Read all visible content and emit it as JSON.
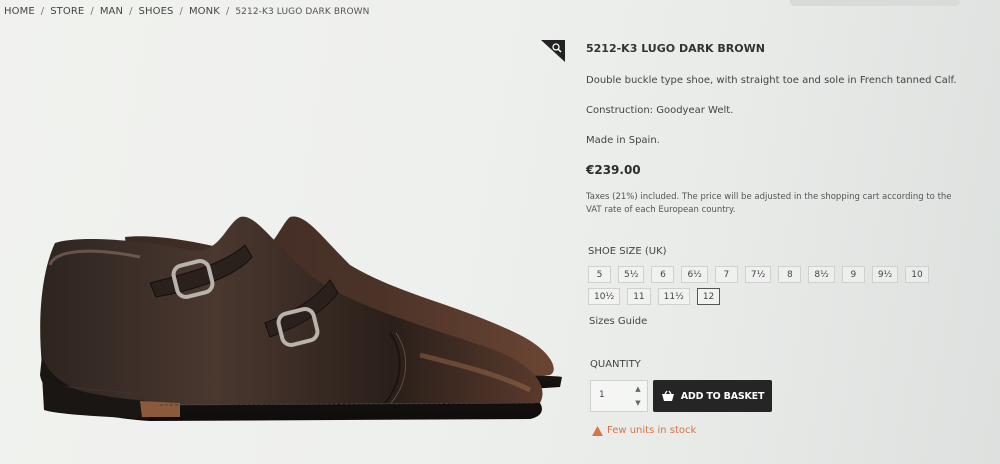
{
  "breadcrumb": {
    "items": [
      "HOME",
      "STORE",
      "MAN",
      "SHOES",
      "MONK"
    ],
    "current": "5212-K3 LUGO DARK BROWN",
    "separator": "/"
  },
  "product": {
    "title": "5212-K3 LUGO DARK BROWN",
    "description": [
      "Double buckle type shoe, with straight toe and sole in French tanned Calf.",
      "Construction: Goodyear Welt.",
      "Made in Spain."
    ],
    "price": "€239.00",
    "tax_note": "Taxes (21%) included. The price will be adjusted in the shopping cart according to the VAT rate of each European country.",
    "image_icon": "double-monk-strap-shoe"
  },
  "sizes": {
    "label": "SHOE SIZE (UK)",
    "options": [
      "5",
      "5½",
      "6",
      "6½",
      "7",
      "7½",
      "8",
      "8½",
      "9",
      "9½",
      "10",
      "10½",
      "11",
      "11½",
      "12"
    ],
    "selected": "12",
    "guide_label": "Sizes Guide"
  },
  "quantity": {
    "label": "QUANTITY",
    "value": "1",
    "up_icon": "chevron-up-icon",
    "down_icon": "chevron-down-icon"
  },
  "cart": {
    "add_label": "ADD TO BASKET",
    "icon": "basket-icon"
  },
  "stock": {
    "text": "Few units in stock",
    "icon": "warning-icon"
  },
  "colors": {
    "button_bg": "#252525",
    "stock_warning": "#d9734a",
    "leather": "#3a2a22"
  }
}
